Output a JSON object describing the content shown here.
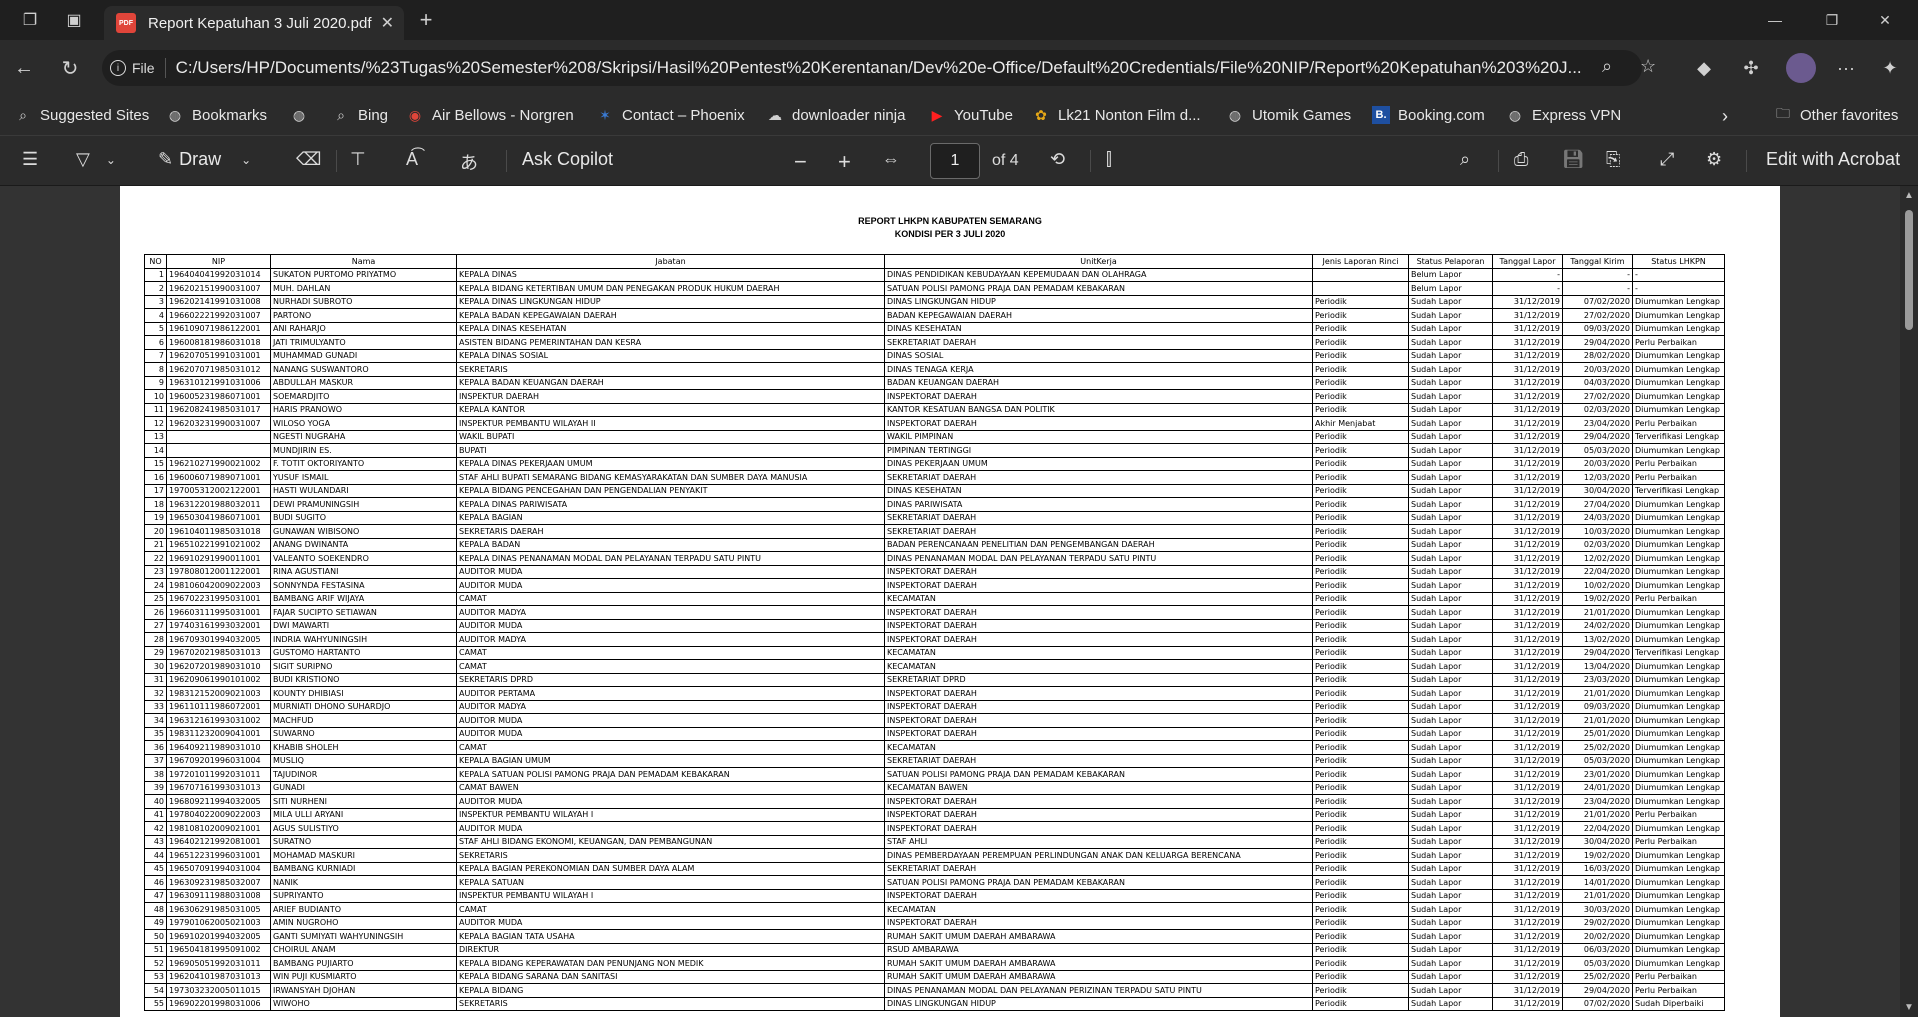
{
  "tab": {
    "title": "Report Kepatuhan 3 Juli 2020.pdf",
    "badge": "PDF"
  },
  "address": {
    "scheme": "File",
    "url": "C:/Users/HP/Documents/%23Tugas%20Semester%208/Skripsi/Hasil%20Pentest%20Kerentanan/Dev%20e-Office/Default%20Credentials/File%20NIP/Report%20Kepatuhan%203%20J..."
  },
  "favorites": [
    "Suggested Sites",
    "Bookmarks",
    "",
    "Bing",
    "Air Bellows - Norgren",
    "Contact – Phoenix",
    "downloader ninja",
    "YouTube",
    "Lk21 Nonton Film d...",
    "Utomik Games",
    "Booking.com",
    "Express VPN"
  ],
  "other_favorites": "Other favorites",
  "toolbar": {
    "draw": "Draw",
    "ask": "Ask Copilot",
    "page": "1",
    "of": "of 4",
    "edit": "Edit with Acrobat"
  },
  "report": {
    "title": "REPORT LHKPN KABUPATEN SEMARANG",
    "subtitle": "KONDISI PER 3 JULI 2020",
    "headers": [
      "NO",
      "NIP",
      "Nama",
      "Jabatan",
      "UnitKerja",
      "Jenis Laporan Rinci",
      "Status Pelaporan",
      "Tanggal Lapor",
      "Tanggal Kirim",
      "Status LHKPN"
    ],
    "rows": [
      [
        "1",
        "196404041992031014",
        "SUKATON PURTOMO PRIYATMO",
        "KEPALA DINAS",
        "DINAS PENDIDIKAN KEBUDAYAAN KEPEMUDAAN DAN OLAHRAGA",
        "",
        "Belum Lapor",
        "-",
        "-",
        "-"
      ],
      [
        "2",
        "196202151990031007",
        "MUH. DAHLAN",
        "KEPALA BIDANG KETERTIBAN UMUM DAN PENEGAKAN PRODUK HUKUM DAERAH",
        "SATUAN POLISI PAMONG PRAJA DAN PEMADAM KEBAKARAN",
        "",
        "Belum Lapor",
        "-",
        "-",
        "-"
      ],
      [
        "3",
        "196202141991031008",
        "NURHADI SUBROTO",
        "KEPALA DINAS LINGKUNGAN HIDUP",
        "DINAS LINGKUNGAN HIDUP",
        "Periodik",
        "Sudah Lapor",
        "31/12/2019",
        "07/02/2020",
        "Diumumkan Lengkap"
      ],
      [
        "4",
        "196602221992031007",
        "PARTONO",
        "KEPALA BADAN KEPEGAWAIAN DAERAH",
        "BADAN KEPEGAWAIAN DAERAH",
        "Periodik",
        "Sudah Lapor",
        "31/12/2019",
        "27/02/2020",
        "Diumumkan Lengkap"
      ],
      [
        "5",
        "196109071986122001",
        "ANI RAHARJO",
        "KEPALA DINAS KESEHATAN",
        "DINAS KESEHATAN",
        "Periodik",
        "Sudah Lapor",
        "31/12/2019",
        "09/03/2020",
        "Diumumkan Lengkap"
      ],
      [
        "6",
        "196008181986031018",
        "JATI TRIMULYANTO",
        "ASISTEN BIDANG PEMERINTAHAN DAN KESRA",
        "SEKRETARIAT DAERAH",
        "Periodik",
        "Sudah Lapor",
        "31/12/2019",
        "29/04/2020",
        "Perlu Perbaikan"
      ],
      [
        "7",
        "196207051991031001",
        "MUHAMMAD GUNADI",
        "KEPALA DINAS SOSIAL",
        "DINAS SOSIAL",
        "Periodik",
        "Sudah Lapor",
        "31/12/2019",
        "28/02/2020",
        "Diumumkan Lengkap"
      ],
      [
        "8",
        "196207071985031012",
        "NANANG SUSWANTORO",
        "SEKRETARIS",
        "DINAS TENAGA KERJA",
        "Periodik",
        "Sudah Lapor",
        "31/12/2019",
        "20/03/2020",
        "Diumumkan Lengkap"
      ],
      [
        "9",
        "196310121991031006",
        "ABDULLAH MASKUR",
        "KEPALA BADAN KEUANGAN DAERAH",
        "BADAN KEUANGAN DAERAH",
        "Periodik",
        "Sudah Lapor",
        "31/12/2019",
        "04/03/2020",
        "Diumumkan Lengkap"
      ],
      [
        "10",
        "196005231986071001",
        "SOEMARDJITO",
        "INSPEKTUR DAERAH",
        "INSPEKTORAT DAERAH",
        "Periodik",
        "Sudah Lapor",
        "31/12/2019",
        "27/02/2020",
        "Diumumkan Lengkap"
      ],
      [
        "11",
        "196208241985031017",
        "HARIS PRANOWO",
        "KEPALA KANTOR",
        "KANTOR KESATUAN BANGSA DAN POLITIK",
        "Periodik",
        "Sudah Lapor",
        "31/12/2019",
        "02/03/2020",
        "Diumumkan Lengkap"
      ],
      [
        "12",
        "196203231990031007",
        "WILOSO YOGA",
        "INSPEKTUR PEMBANTU WILAYAH II",
        "INSPEKTORAT DAERAH",
        "Akhir Menjabat",
        "Sudah Lapor",
        "31/12/2019",
        "23/04/2020",
        "Perlu Perbaikan"
      ],
      [
        "13",
        "",
        "NGESTI NUGRAHA",
        "WAKIL BUPATI",
        "WAKIL PIMPINAN",
        "Periodik",
        "Sudah Lapor",
        "31/12/2019",
        "29/04/2020",
        "Terverifikasi Lengkap"
      ],
      [
        "14",
        "",
        "MUNDJIRIN ES.",
        "BUPATI",
        "PIMPINAN TERTINGGI",
        "Periodik",
        "Sudah Lapor",
        "31/12/2019",
        "05/03/2020",
        "Diumumkan Lengkap"
      ],
      [
        "15",
        "196210271990021002",
        "F. TOTIT OKTORIYANTO",
        "KEPALA DINAS PEKERJAAN UMUM",
        "DINAS PEKERJAAN UMUM",
        "Periodik",
        "Sudah Lapor",
        "31/12/2019",
        "20/03/2020",
        "Perlu Perbaikan"
      ],
      [
        "16",
        "196006071989071001",
        "YUSUF ISMAIL",
        "STAF AHLI BUPATI SEMARANG BIDANG KEMASYARAKATAN DAN SUMBER DAYA MANUSIA",
        "SEKRETARIAT DAERAH",
        "Periodik",
        "Sudah Lapor",
        "31/12/2019",
        "12/03/2020",
        "Perlu Perbaikan"
      ],
      [
        "17",
        "197005312002122001",
        "HASTI WULANDARI",
        "KEPALA BIDANG PENCEGAHAN DAN PENGENDALIAN PENYAKIT",
        "DINAS KESEHATAN",
        "Periodik",
        "Sudah Lapor",
        "31/12/2019",
        "30/04/2020",
        "Terverifikasi Lengkap"
      ],
      [
        "18",
        "196312201988032011",
        "DEWI PRAMUNINGSIH",
        "KEPALA DINAS PARIWISATA",
        "DINAS PARIWISATA",
        "Periodik",
        "Sudah Lapor",
        "31/12/2019",
        "27/04/2020",
        "Diumumkan Lengkap"
      ],
      [
        "19",
        "196503041986071001",
        "BUDI SUGITO",
        "KEPALA BAGIAN",
        "SEKRETARIAT DAERAH",
        "Periodik",
        "Sudah Lapor",
        "31/12/2019",
        "24/03/2020",
        "Diumumkan Lengkap"
      ],
      [
        "20",
        "196104011985031018",
        "GUNAWAN WIBISONO",
        "SEKRETARIS DAERAH",
        "SEKRETARIAT DAERAH",
        "Periodik",
        "Sudah Lapor",
        "31/12/2019",
        "10/03/2020",
        "Diumumkan Lengkap"
      ],
      [
        "21",
        "196510221991021002",
        "ANANG DWINANTA",
        "KEPALA BADAN",
        "BADAN PERENCANAAN PENELITIAN DAN PENGEMBANGAN DAERAH",
        "Periodik",
        "Sudah Lapor",
        "31/12/2019",
        "02/03/2020",
        "Diumumkan Lengkap"
      ],
      [
        "22",
        "196910291990011001",
        "VALEANTO SOEKENDRO",
        "KEPALA DINAS PENANAMAN MODAL DAN PELAYANAN TERPADU SATU PINTU",
        "DINAS PENANAMAN MODAL DAN PELAYANAN TERPADU SATU PINTU",
        "Periodik",
        "Sudah Lapor",
        "31/12/2019",
        "12/02/2020",
        "Diumumkan Lengkap"
      ],
      [
        "23",
        "197808012001122001",
        "RINA AGUSTIANI",
        "AUDITOR MUDA",
        "INSPEKTORAT DAERAH",
        "Periodik",
        "Sudah Lapor",
        "31/12/2019",
        "22/04/2020",
        "Diumumkan Lengkap"
      ],
      [
        "24",
        "198106042009022003",
        "SONNYNDA FESTASINA",
        "AUDITOR MUDA",
        "INSPEKTORAT DAERAH",
        "Periodik",
        "Sudah Lapor",
        "31/12/2019",
        "10/02/2020",
        "Diumumkan Lengkap"
      ],
      [
        "25",
        "196702231995031001",
        "BAMBANG ARIF WIJAYA",
        "CAMAT",
        "KECAMATAN",
        "Periodik",
        "Sudah Lapor",
        "31/12/2019",
        "19/02/2020",
        "Perlu Perbaikan"
      ],
      [
        "26",
        "196603111995031001",
        "FAJAR SUCIPTO SETIAWAN",
        "AUDITOR MADYA",
        "INSPEKTORAT DAERAH",
        "Periodik",
        "Sudah Lapor",
        "31/12/2019",
        "21/01/2020",
        "Diumumkan Lengkap"
      ],
      [
        "27",
        "197403161993032001",
        "DWI MAWARTI",
        "AUDITOR MUDA",
        "INSPEKTORAT DAERAH",
        "Periodik",
        "Sudah Lapor",
        "31/12/2019",
        "24/02/2020",
        "Diumumkan Lengkap"
      ],
      [
        "28",
        "196709301994032005",
        "INDRIA WAHYUNINGSIH",
        "AUDITOR MADYA",
        "INSPEKTORAT DAERAH",
        "Periodik",
        "Sudah Lapor",
        "31/12/2019",
        "13/02/2020",
        "Diumumkan Lengkap"
      ],
      [
        "29",
        "196702021985031013",
        "GUSTOMO HARTANTO",
        "CAMAT",
        "KECAMATAN",
        "Periodik",
        "Sudah Lapor",
        "31/12/2019",
        "29/04/2020",
        "Terverifikasi Lengkap"
      ],
      [
        "30",
        "196207201989031010",
        "SIGIT SURIPNO",
        "CAMAT",
        "KECAMATAN",
        "Periodik",
        "Sudah Lapor",
        "31/12/2019",
        "13/04/2020",
        "Diumumkan Lengkap"
      ],
      [
        "31",
        "196209061990101002",
        "BUDI KRISTIONO",
        "SEKRETARIS DPRD",
        "SEKRETARIAT DPRD",
        "Periodik",
        "Sudah Lapor",
        "31/12/2019",
        "23/03/2020",
        "Diumumkan Lengkap"
      ],
      [
        "32",
        "198312152009021003",
        "KOUNTY DHIBIASI",
        "AUDITOR PERTAMA",
        "INSPEKTORAT DAERAH",
        "Periodik",
        "Sudah Lapor",
        "31/12/2019",
        "21/01/2020",
        "Diumumkan Lengkap"
      ],
      [
        "33",
        "196110111986072001",
        "MURNIATI DHONO SUHARDJO",
        "AUDITOR MADYA",
        "INSPEKTORAT DAERAH",
        "Periodik",
        "Sudah Lapor",
        "31/12/2019",
        "09/03/2020",
        "Diumumkan Lengkap"
      ],
      [
        "34",
        "196312161993031002",
        "MACHFUD",
        "AUDITOR MUDA",
        "INSPEKTORAT DAERAH",
        "Periodik",
        "Sudah Lapor",
        "31/12/2019",
        "21/01/2020",
        "Diumumkan Lengkap"
      ],
      [
        "35",
        "198311232009041001",
        "SUWARNO",
        "AUDITOR MUDA",
        "INSPEKTORAT DAERAH",
        "Periodik",
        "Sudah Lapor",
        "31/12/2019",
        "25/01/2020",
        "Diumumkan Lengkap"
      ],
      [
        "36",
        "196409211989031010",
        "KHABIB SHOLEH",
        "CAMAT",
        "KECAMATAN",
        "Periodik",
        "Sudah Lapor",
        "31/12/2019",
        "25/02/2020",
        "Diumumkan Lengkap"
      ],
      [
        "37",
        "196709201996031004",
        "MUSLIQ",
        "KEPALA BAGIAN UMUM",
        "SEKRETARIAT DAERAH",
        "Periodik",
        "Sudah Lapor",
        "31/12/2019",
        "05/03/2020",
        "Diumumkan Lengkap"
      ],
      [
        "38",
        "197201011992031011",
        "TAJUDINOR",
        "KEPALA SATUAN POLISI PAMONG PRAJA DAN PEMADAM KEBAKARAN",
        "SATUAN POLISI PAMONG PRAJA DAN PEMADAM KEBAKARAN",
        "Periodik",
        "Sudah Lapor",
        "31/12/2019",
        "23/01/2020",
        "Diumumkan Lengkap"
      ],
      [
        "39",
        "196707161993031013",
        "GUNADI",
        "CAMAT BAWEN",
        "KECAMATAN BAWEN",
        "Periodik",
        "Sudah Lapor",
        "31/12/2019",
        "24/01/2020",
        "Diumumkan Lengkap"
      ],
      [
        "40",
        "196809211994032005",
        "SITI NURHENI",
        "AUDITOR MUDA",
        "INSPEKTORAT DAERAH",
        "Periodik",
        "Sudah Lapor",
        "31/12/2019",
        "23/04/2020",
        "Diumumkan Lengkap"
      ],
      [
        "41",
        "197804022009022003",
        "MILA ULLI ARYANI",
        "INSPEKTUR PEMBANTU WILAYAH I",
        "INSPEKTORAT DAERAH",
        "Periodik",
        "Sudah Lapor",
        "31/12/2019",
        "21/01/2020",
        "Perlu Perbaikan"
      ],
      [
        "42",
        "198108102009021001",
        "AGUS SULISTIYO",
        "AUDITOR MUDA",
        "INSPEKTORAT DAERAH",
        "Periodik",
        "Sudah Lapor",
        "31/12/2019",
        "22/04/2020",
        "Diumumkan Lengkap"
      ],
      [
        "43",
        "196402121992081001",
        "SURATNO",
        "STAF AHLI BIDANG EKONOMI, KEUANGAN, DAN PEMBANGUNAN",
        "STAF AHLI",
        "Periodik",
        "Sudah Lapor",
        "31/12/2019",
        "30/04/2020",
        "Perlu Perbaikan"
      ],
      [
        "44",
        "196512231996031001",
        "MOHAMAD MASKURI",
        "SEKRETARIS",
        "DINAS PEMBERDAYAAN PEREMPUAN PERLINDUNGAN ANAK DAN KELUARGA BERENCANA",
        "Periodik",
        "Sudah Lapor",
        "31/12/2019",
        "19/02/2020",
        "Diumumkan Lengkap"
      ],
      [
        "45",
        "196507091994031004",
        "BAMBANG KURNIADI",
        "KEPALA BAGIAN PEREKONOMIAN DAN SUMBER DAYA ALAM",
        "SEKRETARIAT DAERAH",
        "Periodik",
        "Sudah Lapor",
        "31/12/2019",
        "16/03/2020",
        "Diumumkan Lengkap"
      ],
      [
        "46",
        "196309231985032007",
        "NANIK",
        "KEPALA SATUAN",
        "SATUAN POLISI PAMONG PRAJA DAN PEMADAM KEBAKARAN",
        "Periodik",
        "Sudah Lapor",
        "31/12/2019",
        "14/01/2020",
        "Diumumkan Lengkap"
      ],
      [
        "47",
        "196309111988031008",
        "SUPRIYANTO",
        "INSPEKTUR PEMBANTU WILAYAH I",
        "INSPEKTORAT DAERAH",
        "Periodik",
        "Sudah Lapor",
        "31/12/2019",
        "21/01/2020",
        "Diumumkan Lengkap"
      ],
      [
        "48",
        "196306291985031005",
        "ARIEF BUDIANTO",
        "CAMAT",
        "KECAMATAN",
        "Periodik",
        "Sudah Lapor",
        "31/12/2019",
        "30/03/2020",
        "Diumumkan Lengkap"
      ],
      [
        "49",
        "197901062005021003",
        "AMIN NUGROHO",
        "AUDITOR MUDA",
        "INSPEKTORAT DAERAH",
        "Periodik",
        "Sudah Lapor",
        "31/12/2019",
        "29/02/2020",
        "Diumumkan Lengkap"
      ],
      [
        "50",
        "196910201994032005",
        "GANTI SUMIYATI WAHYUNINGSIH",
        "KEPALA BAGIAN TATA USAHA",
        "RUMAH SAKIT UMUM DAERAH AMBARAWA",
        "Periodik",
        "Sudah Lapor",
        "31/12/2019",
        "20/02/2020",
        "Diumumkan Lengkap"
      ],
      [
        "51",
        "196504181995091002",
        "CHOIRUL ANAM",
        "DIREKTUR",
        "RSUD AMBARAWA",
        "Periodik",
        "Sudah Lapor",
        "31/12/2019",
        "06/03/2020",
        "Diumumkan Lengkap"
      ],
      [
        "52",
        "196905051992031011",
        "BAMBANG PUJIARTO",
        "KEPALA BIDANG KEPERAWATAN DAN PENUNJANG NON MEDIK",
        "RUMAH SAKIT UMUM DAERAH AMBARAWA",
        "Periodik",
        "Sudah Lapor",
        "31/12/2019",
        "05/03/2020",
        "Diumumkan Lengkap"
      ],
      [
        "53",
        "196204101987031013",
        "WIN PUJI KUSMIARTO",
        "KEPALA BIDANG SARANA DAN SANITASI",
        "RUMAH SAKIT UMUM DAERAH AMBARAWA",
        "Periodik",
        "Sudah Lapor",
        "31/12/2019",
        "25/02/2020",
        "Perlu Perbaikan"
      ],
      [
        "54",
        "197303232005011015",
        "IRWANSYAH DJOHAN",
        "KEPALA BIDANG",
        "DINAS PENANAMAN MODAL DAN PELAYANAN PERIZINAN TERPADU SATU PINTU",
        "Periodik",
        "Sudah Lapor",
        "31/12/2019",
        "29/04/2020",
        "Perlu Perbaikan"
      ],
      [
        "55",
        "196902201998031006",
        "WIWOHO",
        "SEKRETARIS",
        "DINAS LINGKUNGAN HIDUP",
        "Periodik",
        "Sudah Lapor",
        "31/12/2019",
        "07/02/2020",
        "Sudah Diperbaiki"
      ]
    ]
  }
}
